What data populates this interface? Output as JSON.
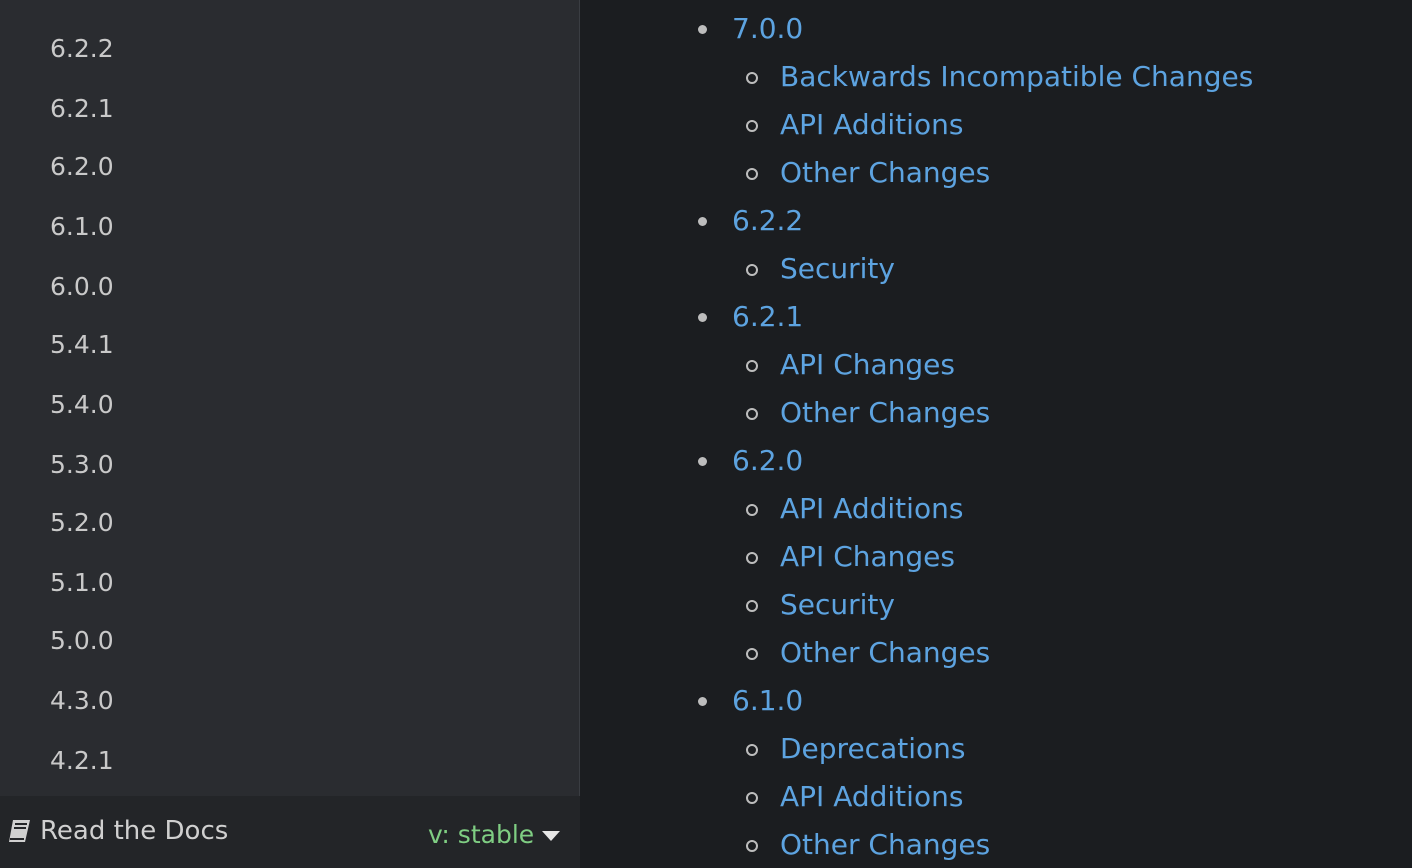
{
  "sidebar": {
    "versions": [
      "6.2.2",
      "6.2.1",
      "6.2.0",
      "6.1.0",
      "6.0.0",
      "5.4.1",
      "5.4.0",
      "5.3.0",
      "5.2.0",
      "5.1.0",
      "5.0.0",
      "4.3.0",
      "4.2.1"
    ]
  },
  "footer": {
    "brand_label": "Read the Docs",
    "version_label": "v: stable"
  },
  "toc": [
    {
      "version": "7.0.0",
      "subsections": [
        "Backwards Incompatible Changes",
        "API Additions",
        "Other Changes"
      ]
    },
    {
      "version": "6.2.2",
      "subsections": [
        "Security"
      ]
    },
    {
      "version": "6.2.1",
      "subsections": [
        "API Changes",
        "Other Changes"
      ]
    },
    {
      "version": "6.2.0",
      "subsections": [
        "API Additions",
        "API Changes",
        "Security",
        "Other Changes"
      ]
    },
    {
      "version": "6.1.0",
      "subsections": [
        "Deprecations",
        "API Additions",
        "Other Changes"
      ]
    }
  ],
  "colors": {
    "link": "#5da3e0",
    "version_badge": "#7fce83",
    "sidebar_bg": "#2a2c30",
    "main_bg": "#1b1d20"
  },
  "icons": {
    "brand": "book-icon",
    "version_dropdown": "caret-down-icon"
  }
}
